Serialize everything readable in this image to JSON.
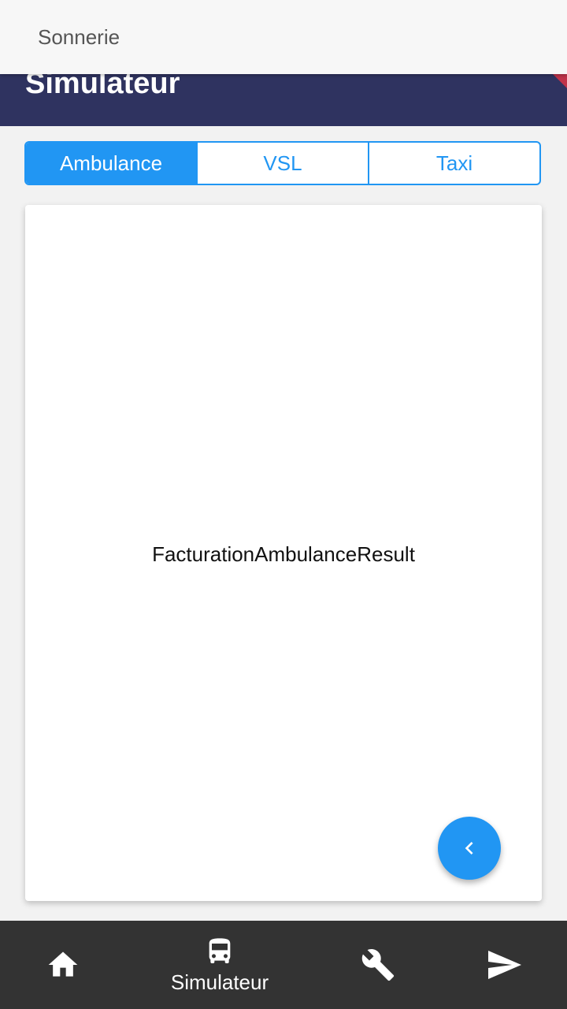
{
  "notification": {
    "text": "Sonnerie"
  },
  "header": {
    "title": "Simulateur"
  },
  "tabs": [
    {
      "label": "Ambulance",
      "active": true
    },
    {
      "label": "VSL",
      "active": false
    },
    {
      "label": "Taxi",
      "active": false
    }
  ],
  "card": {
    "text": "FacturationAmbulanceResult"
  },
  "fab": {
    "icon": "chevron-left-icon"
  },
  "bottom_nav": {
    "items": [
      {
        "icon": "home-icon",
        "label": ""
      },
      {
        "icon": "bus-icon",
        "label": "Simulateur",
        "active": true
      },
      {
        "icon": "wrench-icon",
        "label": ""
      },
      {
        "icon": "send-icon",
        "label": ""
      }
    ]
  },
  "colors": {
    "header_bg": "#2f3360",
    "accent": "#2196f3",
    "nav_bg": "#333333",
    "corner_accent": "#c0334a"
  }
}
